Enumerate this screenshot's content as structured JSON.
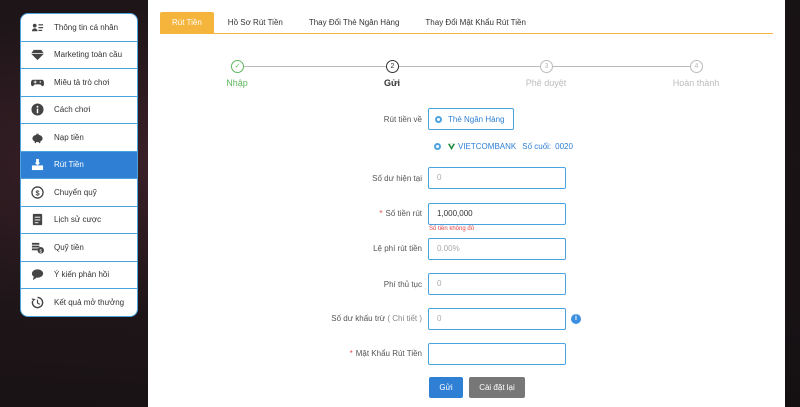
{
  "sidebar": {
    "items": [
      {
        "label": "Thông tin cá nhân",
        "icon": "user-card-icon"
      },
      {
        "label": "Marketing toàn cầu",
        "icon": "diamond-icon"
      },
      {
        "label": "Miêu tả trò chơi",
        "icon": "gamepad-icon"
      },
      {
        "label": "Cách chơi",
        "icon": "info-icon"
      },
      {
        "label": "Nạp tiền",
        "icon": "piggy-bank-icon"
      },
      {
        "label": "Rút Tiền",
        "icon": "withdraw-icon",
        "active": true
      },
      {
        "label": "Chuyển quỹ",
        "icon": "dollar-circle-icon"
      },
      {
        "label": "Lịch sử cược",
        "icon": "document-icon"
      },
      {
        "label": "Quỹ tiền",
        "icon": "coins-icon"
      },
      {
        "label": "Ý kiến phản hồi",
        "icon": "chat-icon"
      },
      {
        "label": "Kết quả mở thưởng",
        "icon": "history-icon"
      }
    ]
  },
  "tabs": [
    {
      "label": "Rút Tiền",
      "active": true
    },
    {
      "label": "Hồ Sơ Rút Tiền"
    },
    {
      "label": "Thay Đổi Thẻ Ngân Hàng"
    },
    {
      "label": "Thay Đổi Mật Khẩu Rút Tiền"
    }
  ],
  "steps": [
    {
      "num": "✓",
      "label": "Nhập",
      "state": "done"
    },
    {
      "num": "2",
      "label": "Gửi",
      "state": "current"
    },
    {
      "num": "3",
      "label": "Phê duyệt",
      "state": "pending"
    },
    {
      "num": "4",
      "label": "Hoàn thành",
      "state": "pending"
    }
  ],
  "form": {
    "withdraw_to_label": "Rút tiền về",
    "withdraw_to_option": "Thẻ Ngân Hàng",
    "bank_name": "VIETCOMBANK",
    "bank_last_digits_label": "Số cuối:",
    "bank_last_digits": "0020",
    "current_balance_label": "Số dư hiện tại",
    "current_balance_placeholder": "0",
    "amount_label": "Số tiền rút",
    "amount_value": "1,000,000",
    "amount_error": "Số tiền không đủ",
    "fee_rate_label": "Lệ phí rút tiền",
    "fee_rate_placeholder": "0.00%",
    "fee_label": "Phí thủ tục",
    "fee_placeholder": "0",
    "deduct_label": "Số dư khấu trừ",
    "deduct_detail_label": "( Chi tiết )",
    "deduct_placeholder": "0",
    "password_label": "Mật Khẩu Rút Tiền",
    "password_value": "",
    "info_icon": "i"
  },
  "buttons": {
    "submit": "Gửi",
    "reset": "Cài đặt lại"
  },
  "colors": {
    "accent": "#2f7fd4",
    "tab_active": "#f5b43c",
    "done": "#5cb85c",
    "error": "#e04545"
  }
}
